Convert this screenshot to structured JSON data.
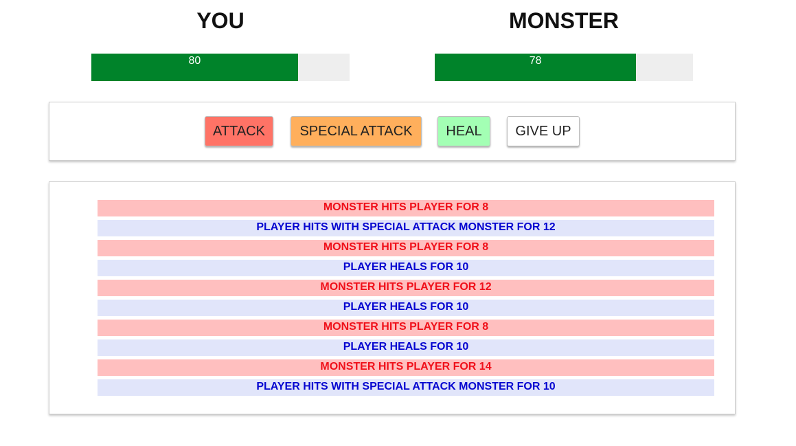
{
  "player": {
    "name": "YOU",
    "health": 80,
    "health_label": "80"
  },
  "monster": {
    "name": "MONSTER",
    "health": 78,
    "health_label": "78"
  },
  "colors": {
    "health_fill": "#00832a",
    "health_track": "#eeeeee",
    "attack": "#ff7366",
    "special_attack": "#ffaf5c",
    "heal": "#a3ffb4",
    "give_up": "#ffffff",
    "monster_log_bg": "#ffbfbf",
    "monster_log_text": "#f0101a",
    "player_log_bg": "#e1e5fa",
    "player_log_text": "#0505d0"
  },
  "controls": {
    "attack_label": "ATTACK",
    "special_attack_label": "SPECIAL ATTACK",
    "heal_label": "HEAL",
    "give_up_label": "GIVE UP"
  },
  "log": [
    {
      "actor": "monster",
      "text": "MONSTER HITS PLAYER FOR 8"
    },
    {
      "actor": "player",
      "text": "PLAYER HITS WITH SPECIAL ATTACK MONSTER FOR 12"
    },
    {
      "actor": "monster",
      "text": "MONSTER HITS PLAYER FOR 8"
    },
    {
      "actor": "player",
      "text": "PLAYER HEALS FOR 10"
    },
    {
      "actor": "monster",
      "text": "MONSTER HITS PLAYER FOR 12"
    },
    {
      "actor": "player",
      "text": "PLAYER HEALS FOR 10"
    },
    {
      "actor": "monster",
      "text": "MONSTER HITS PLAYER FOR 8"
    },
    {
      "actor": "player",
      "text": "PLAYER HEALS FOR 10"
    },
    {
      "actor": "monster",
      "text": "MONSTER HITS PLAYER FOR 14"
    },
    {
      "actor": "player",
      "text": "PLAYER HITS WITH SPECIAL ATTACK MONSTER FOR 10"
    }
  ]
}
